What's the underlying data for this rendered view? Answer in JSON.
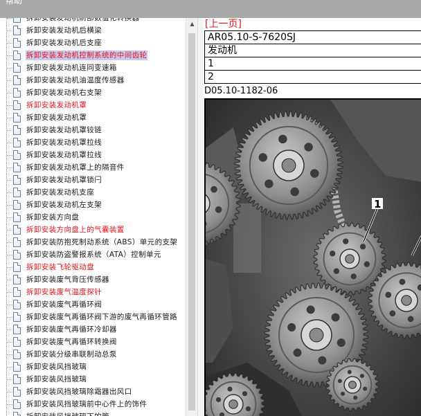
{
  "window": {
    "title": "帮助"
  },
  "tree": {
    "items": [
      {
        "label": "拆卸安装发动机前部数值化转换器",
        "style": "normal"
      },
      {
        "label": "拆卸安装发动机后横梁",
        "style": "normal"
      },
      {
        "label": "拆卸安装发动机后支座",
        "style": "normal"
      },
      {
        "label": "拆卸安装发动机控制系统的中间齿轮",
        "style": "selected"
      },
      {
        "label": "拆卸安装发动机连同变速箱",
        "style": "normal"
      },
      {
        "label": "拆卸安装发动机油温度传感器",
        "style": "normal"
      },
      {
        "label": "拆卸安装发动机右支架",
        "style": "normal"
      },
      {
        "label": "拆卸安装发动机罩",
        "style": "red"
      },
      {
        "label": "拆卸安装发动机罩",
        "style": "normal"
      },
      {
        "label": "拆卸安装发动机罩铰链",
        "style": "normal"
      },
      {
        "label": "拆卸安装发动机罩拉线",
        "style": "normal"
      },
      {
        "label": "拆卸安装发动机罩拉线",
        "style": "normal"
      },
      {
        "label": "拆卸安装发动机罩上的隔音件",
        "style": "normal"
      },
      {
        "label": "拆卸安装发动机罩锁闩",
        "style": "normal"
      },
      {
        "label": "拆卸安装发动机支座",
        "style": "normal"
      },
      {
        "label": "拆卸安装发动机左支架",
        "style": "normal"
      },
      {
        "label": "拆卸安装方向盘",
        "style": "normal"
      },
      {
        "label": "拆卸安装方向盘上的气囊装置",
        "style": "red"
      },
      {
        "label": "拆卸安装防抱死制动系统（ABS）单元的支架",
        "style": "normal"
      },
      {
        "label": "拆卸安装防盗警报系统（ATA）控制单元",
        "style": "normal"
      },
      {
        "label": "拆卸安装飞轮驱动盘",
        "style": "red"
      },
      {
        "label": "拆卸安装废气背压传感器",
        "style": "normal"
      },
      {
        "label": "拆卸安装废气温度探针",
        "style": "red"
      },
      {
        "label": "拆卸安装废气再循环阀",
        "style": "normal"
      },
      {
        "label": "拆卸安装废气再循环阀下游的废气再循环管路",
        "style": "normal"
      },
      {
        "label": "拆卸安装废气再循环冷却器",
        "style": "normal"
      },
      {
        "label": "拆卸安装废气再循环转换阀",
        "style": "normal"
      },
      {
        "label": "拆卸安装分级串联制动总泵",
        "style": "normal"
      },
      {
        "label": "拆卸安装风挡玻璃",
        "style": "normal"
      },
      {
        "label": "拆卸安装风挡玻璃",
        "style": "normal"
      },
      {
        "label": "拆卸安装风挡玻璃除霜器出风口",
        "style": "normal"
      },
      {
        "label": "拆卸安装风挡玻璃前中心件上的饰件",
        "style": "normal"
      },
      {
        "label": "拆卸安装风挡玻璃下的管",
        "style": "normal"
      }
    ]
  },
  "scrollbar": {
    "up_arrow": "▲"
  },
  "content": {
    "prev_link": "[上一页]",
    "table_rows": [
      "AR05.10-S-7620SJ",
      "发动机",
      "1",
      "2"
    ],
    "doc_ref": "D05.10-1182-06",
    "figure_callout": "1"
  }
}
